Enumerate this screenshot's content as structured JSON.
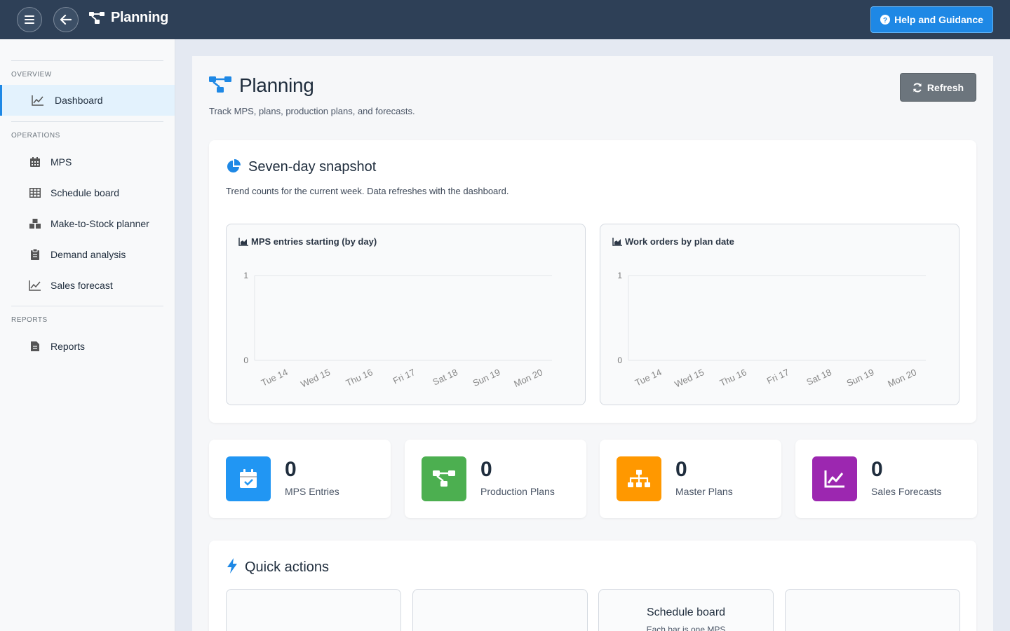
{
  "topbar": {
    "title": "Planning",
    "help_label": "Help and Guidance",
    "colors": {
      "bg": "#2e4057",
      "help": "#1e88e5"
    }
  },
  "sidebar": {
    "sections": [
      {
        "label": "OVERVIEW",
        "items": [
          {
            "label": "Dashboard",
            "icon": "line-chart-icon",
            "active": true
          }
        ]
      },
      {
        "label": "OPERATIONS",
        "items": [
          {
            "label": "MPS",
            "icon": "calendar-icon"
          },
          {
            "label": "Schedule board",
            "icon": "table-icon"
          },
          {
            "label": "Make-to-Stock planner",
            "icon": "boxes-icon"
          },
          {
            "label": "Demand analysis",
            "icon": "clipboard-icon"
          },
          {
            "label": "Sales forecast",
            "icon": "line-chart-icon"
          }
        ]
      },
      {
        "label": "REPORTS",
        "items": [
          {
            "label": "Reports",
            "icon": "document-icon"
          }
        ]
      }
    ]
  },
  "page": {
    "title": "Planning",
    "subtitle": "Track MPS, plans, production plans, and forecasts.",
    "refresh_label": "Refresh"
  },
  "snapshot": {
    "title": "Seven-day snapshot",
    "description": "Trend counts for the current week. Data refreshes with the dashboard."
  },
  "chart_data": [
    {
      "type": "line",
      "title": "MPS entries starting (by day)",
      "categories": [
        "Tue 14",
        "Wed 15",
        "Thu 16",
        "Fri 17",
        "Sat 18",
        "Sun 19",
        "Mon 20"
      ],
      "values": [
        0,
        0,
        0,
        0,
        0,
        0,
        0
      ],
      "ylim": [
        0,
        1
      ],
      "yticks": [
        "0",
        "1"
      ],
      "xlabel": "",
      "ylabel": "",
      "grid": true
    },
    {
      "type": "line",
      "title": "Work orders by plan date",
      "categories": [
        "Tue 14",
        "Wed 15",
        "Thu 16",
        "Fri 17",
        "Sat 18",
        "Sun 19",
        "Mon 20"
      ],
      "values": [
        0,
        0,
        0,
        0,
        0,
        0,
        0
      ],
      "ylim": [
        0,
        1
      ],
      "yticks": [
        "0",
        "1"
      ],
      "xlabel": "",
      "ylabel": "",
      "grid": true
    }
  ],
  "stats": [
    {
      "value": "0",
      "label": "MPS Entries",
      "icon": "calendar-check-icon",
      "color": "#2196f3"
    },
    {
      "value": "0",
      "label": "Production Plans",
      "icon": "sitemap-icon",
      "color": "#4caf50"
    },
    {
      "value": "0",
      "label": "Master Plans",
      "icon": "hierarchy-icon",
      "color": "#ff9800"
    },
    {
      "value": "0",
      "label": "Sales Forecasts",
      "icon": "trend-icon",
      "color": "#9c27b0"
    }
  ],
  "quick_actions": {
    "title": "Quick actions",
    "cards": [
      {
        "title": "",
        "description": ""
      },
      {
        "title": "",
        "description": ""
      },
      {
        "title": "Schedule board",
        "description": "Each bar is one MPS"
      },
      {
        "title": "",
        "description": ""
      }
    ]
  }
}
